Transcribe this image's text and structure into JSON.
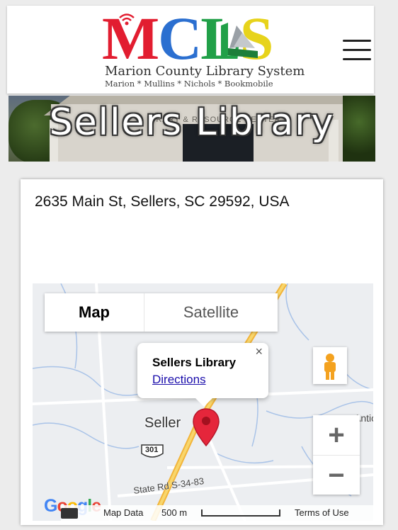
{
  "header": {
    "logo_letters": [
      "M",
      "C",
      "L",
      "S"
    ],
    "logo_title": "Marion County Library System",
    "logo_subtitle": "Marion * Mullins * Nichols * Bookmobile",
    "menu_icon": "hamburger-menu-icon"
  },
  "banner": {
    "title": "Sellers Library",
    "sign_text": "BRARY & RESOURCE CENTER"
  },
  "card": {
    "address": "2635 Main St, Sellers, SC 29592, USA"
  },
  "map": {
    "type_buttons": {
      "map": "Map",
      "satellite": "Satellite"
    },
    "info_window": {
      "title": "Sellers Library",
      "link": "Directions",
      "close": "×"
    },
    "town_label": "Seller",
    "partial_label": "Antio",
    "highway_shield": "301",
    "road_label": "State Rd S-34-83",
    "zoom_in": "+",
    "zoom_out": "−",
    "footer": {
      "map_data": "Map Data",
      "scale": "500 m",
      "terms": "Terms of Use"
    },
    "google_logo": [
      "G",
      "o",
      "o",
      "g",
      "l",
      "e"
    ]
  },
  "colors": {
    "logo_m": "#e21d30",
    "logo_c": "#2b6fd0",
    "logo_l": "#21a048",
    "logo_s": "#e7d31b",
    "pin": "#e5263b",
    "link": "#1a0dab",
    "highway": "#f5c34a"
  }
}
